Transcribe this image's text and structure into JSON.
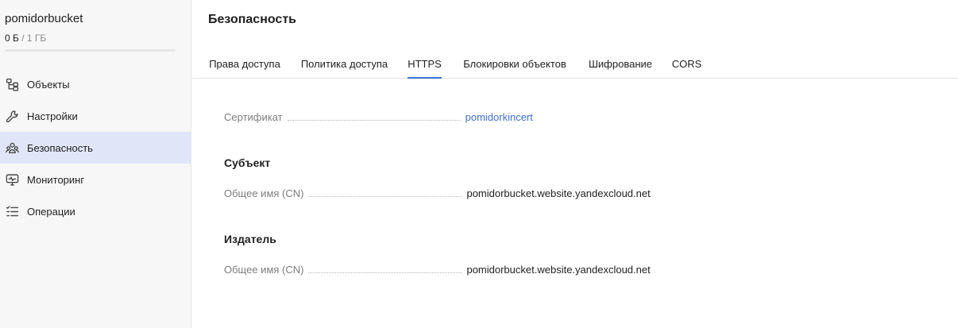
{
  "bucket": {
    "name": "pomidorbucket",
    "used": "0 Б",
    "separator": "/",
    "total": "1 ГБ"
  },
  "sidebar": {
    "items": [
      {
        "label": "Объекты",
        "icon": "objects-icon"
      },
      {
        "label": "Настройки",
        "icon": "wrench-icon"
      },
      {
        "label": "Безопасность",
        "icon": "users-icon",
        "active": true
      },
      {
        "label": "Мониторинг",
        "icon": "monitor-icon"
      },
      {
        "label": "Операции",
        "icon": "list-icon"
      }
    ]
  },
  "page": {
    "title": "Безопасность"
  },
  "tabs": [
    {
      "label": "Права доступа"
    },
    {
      "label": "Политика доступа"
    },
    {
      "label": "HTTPS",
      "active": true
    },
    {
      "label": "Блокировки объектов"
    },
    {
      "label": "Шифрование"
    },
    {
      "label": "CORS"
    }
  ],
  "certificate": {
    "label": "Сертификат",
    "value": "pomidorkincert"
  },
  "subject": {
    "title": "Субъект",
    "cn_label": "Общее имя (CN)",
    "cn_value": "pomidorbucket.website.yandexcloud.net"
  },
  "issuer": {
    "title": "Издатель",
    "cn_label": "Общее имя (CN)",
    "cn_value": "pomidorbucket.website.yandexcloud.net"
  },
  "colors": {
    "accent": "#3f6fd0",
    "active_nav_bg": "#e0e6f7",
    "sidebar_bg": "#f7f7f8"
  }
}
